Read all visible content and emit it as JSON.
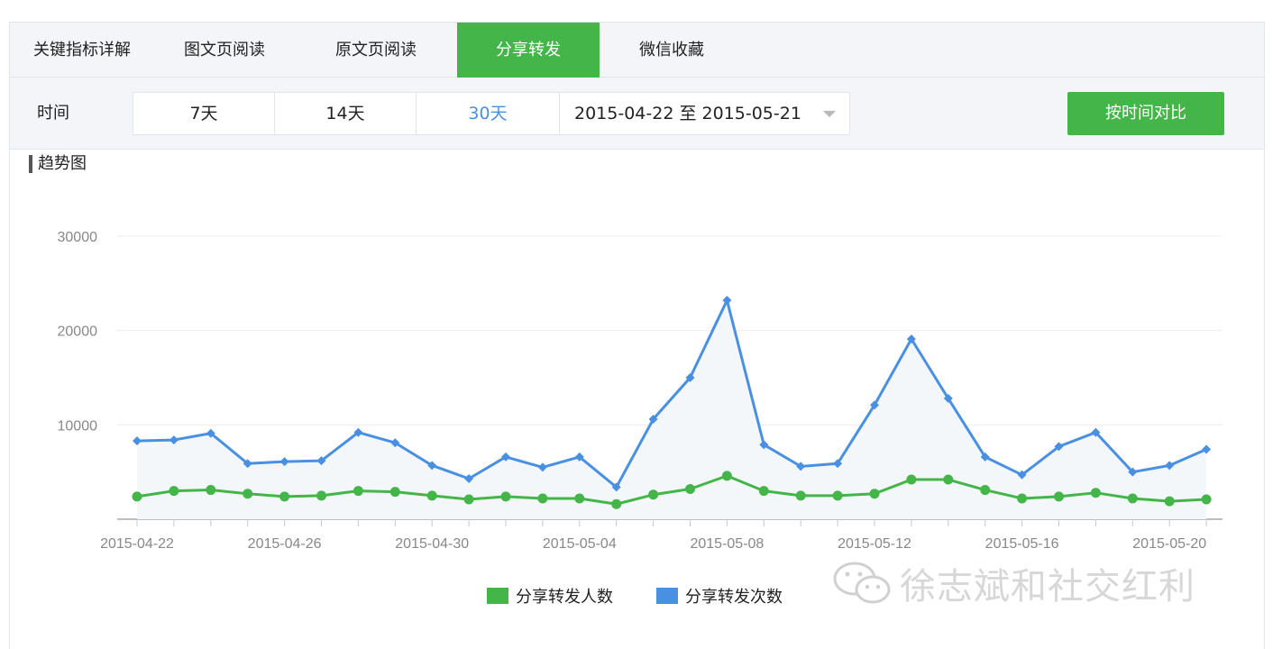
{
  "tabs": [
    {
      "label": "关键指标详解",
      "active": false
    },
    {
      "label": "图文页阅读",
      "active": false
    },
    {
      "label": "原文页阅读",
      "active": false
    },
    {
      "label": "分享转发",
      "active": true
    },
    {
      "label": "微信收藏",
      "active": false
    }
  ],
  "filter": {
    "label": "时间",
    "ranges": [
      {
        "label": "7天",
        "selected": false
      },
      {
        "label": "14天",
        "selected": false
      },
      {
        "label": "30天",
        "selected": true
      }
    ],
    "date_range": "2015-04-22 至 2015-05-21",
    "compare_button": "按时间对比"
  },
  "section_title": "趋势图",
  "watermark": "徐志斌和社交红利",
  "colors": {
    "accent": "#44b549",
    "series_people": "#44b549",
    "series_count": "#4a90e2",
    "selected_text": "#4a90e2"
  },
  "chart_data": {
    "type": "line",
    "x": [
      "2015-04-22",
      "2015-04-23",
      "2015-04-24",
      "2015-04-25",
      "2015-04-26",
      "2015-04-27",
      "2015-04-28",
      "2015-04-29",
      "2015-04-30",
      "2015-05-01",
      "2015-05-02",
      "2015-05-03",
      "2015-05-04",
      "2015-05-05",
      "2015-05-06",
      "2015-05-07",
      "2015-05-08",
      "2015-05-09",
      "2015-05-10",
      "2015-05-11",
      "2015-05-12",
      "2015-05-13",
      "2015-05-14",
      "2015-05-15",
      "2015-05-16",
      "2015-05-17",
      "2015-05-18",
      "2015-05-19",
      "2015-05-20",
      "2015-05-21"
    ],
    "x_tick_labels": [
      "2015-04-22",
      "2015-04-26",
      "2015-04-30",
      "2015-05-04",
      "2015-05-08",
      "2015-05-12",
      "2015-05-16",
      "2015-05-20"
    ],
    "y_ticks": [
      10000,
      20000,
      30000
    ],
    "ylim": [
      0,
      30000
    ],
    "grid": true,
    "legend_position": "bottom-center",
    "series": [
      {
        "name": "分享转发人数",
        "color": "#44b549",
        "marker": "circle",
        "values": [
          2400,
          3000,
          3100,
          2700,
          2400,
          2500,
          3000,
          2900,
          2500,
          2100,
          2400,
          2200,
          2200,
          1600,
          2600,
          3200,
          4600,
          3000,
          2500,
          2500,
          2700,
          4200,
          4200,
          3100,
          2200,
          2400,
          2800,
          2200,
          1900,
          2100
        ]
      },
      {
        "name": "分享转发次数",
        "color": "#4a90e2",
        "marker": "diamond",
        "fill_area": true,
        "values": [
          8300,
          8400,
          9100,
          5900,
          6100,
          6200,
          9200,
          8100,
          5700,
          4300,
          6600,
          5500,
          6600,
          3400,
          10600,
          15000,
          23200,
          7900,
          5600,
          5900,
          12100,
          19100,
          12800,
          6600,
          4700,
          7700,
          9200,
          5000,
          5700,
          7400
        ]
      }
    ]
  }
}
